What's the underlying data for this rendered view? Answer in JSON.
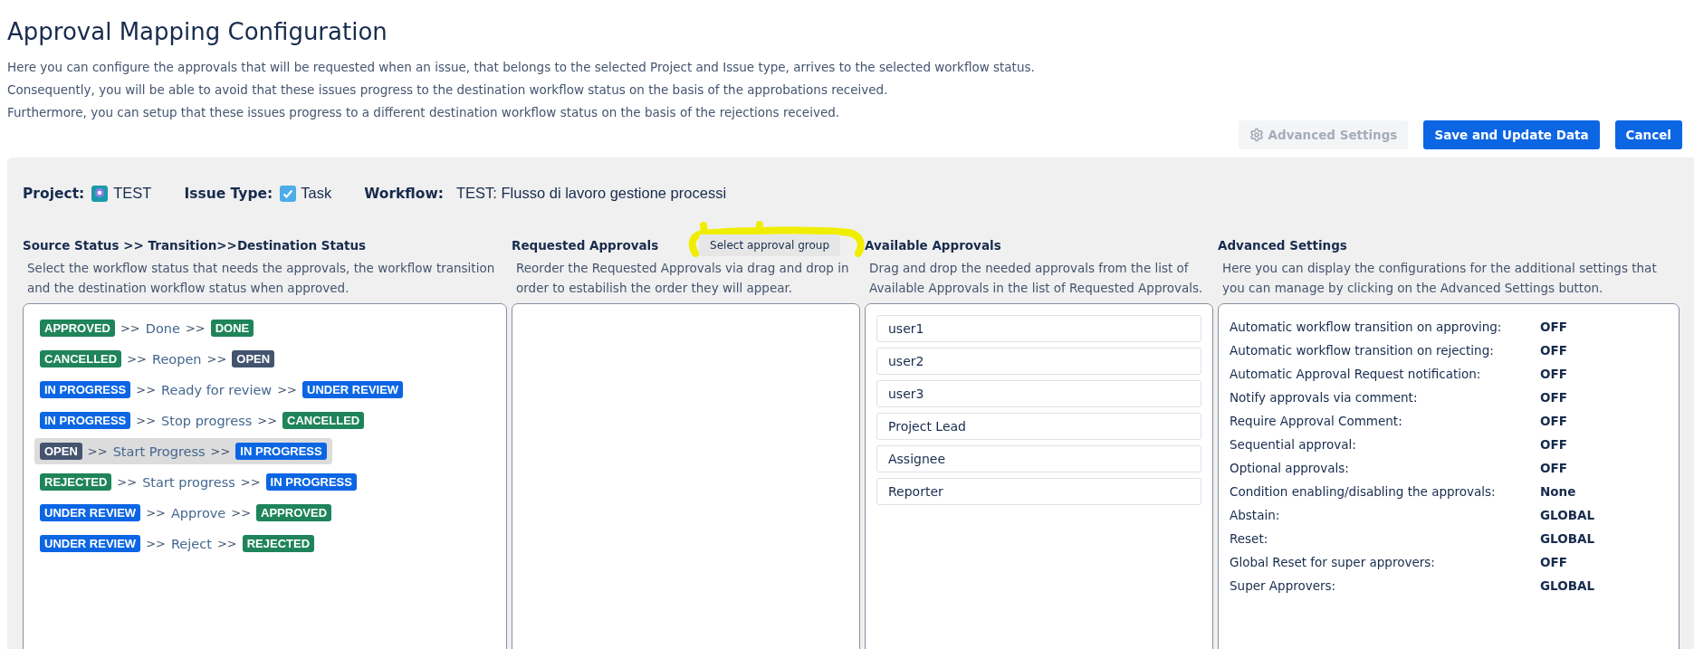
{
  "title": "Approval Mapping Configuration",
  "description": [
    "Here you can configure the approvals that will be requested when an issue, that belongs to the selected Project and Issue type, arrives to the selected workflow status.",
    "Consequently, you will be able to avoid that these issues progress to the destination workflow status on the basis of the approbations received.",
    "Furthermore, you can setup that these issues progress to a different destination workflow status on the basis of the rejections received."
  ],
  "actions": [
    {
      "label": "Advanced Settings",
      "kind": "settings",
      "disabled": true
    },
    {
      "label": "Save and Update Data",
      "kind": "primary",
      "disabled": false
    },
    {
      "label": "Cancel",
      "kind": "primary",
      "disabled": false
    }
  ],
  "context": {
    "project_label": "Project:",
    "project": "TEST",
    "issue_type_label": "Issue Type:",
    "issue_type": "Task",
    "workflow_label": "Workflow:",
    "workflow": "TEST: Flusso di lavoro gestione processi"
  },
  "transitions": {
    "heading": "Source Status >> Transition>>Destination Status",
    "help": "Select the workflow status that needs the approvals, the workflow transition and the destination workflow status when approved.",
    "separator": ">>",
    "rows": [
      {
        "source": {
          "label": "APPROVED",
          "color": "#1f845a"
        },
        "transition": "Done",
        "destination": {
          "label": "DONE",
          "color": "#1f845a"
        },
        "selected": false
      },
      {
        "source": {
          "label": "CANCELLED",
          "color": "#1f845a"
        },
        "transition": "Reopen",
        "destination": {
          "label": "OPEN",
          "color": "#44546f"
        },
        "selected": false
      },
      {
        "source": {
          "label": "IN PROGRESS",
          "color": "#0c66e4"
        },
        "transition": "Ready for review",
        "destination": {
          "label": "UNDER REVIEW",
          "color": "#0c66e4"
        },
        "selected": false
      },
      {
        "source": {
          "label": "IN PROGRESS",
          "color": "#0c66e4"
        },
        "transition": "Stop progress",
        "destination": {
          "label": "CANCELLED",
          "color": "#1f845a"
        },
        "selected": false
      },
      {
        "source": {
          "label": "OPEN",
          "color": "#44546f"
        },
        "transition": "Start Progress",
        "destination": {
          "label": "IN PROGRESS",
          "color": "#0c66e4"
        },
        "selected": true
      },
      {
        "source": {
          "label": "REJECTED",
          "color": "#1f845a"
        },
        "transition": "Start progress",
        "destination": {
          "label": "IN PROGRESS",
          "color": "#0c66e4"
        },
        "selected": false
      },
      {
        "source": {
          "label": "UNDER REVIEW",
          "color": "#0c66e4"
        },
        "transition": "Approve",
        "destination": {
          "label": "APPROVED",
          "color": "#1f845a"
        },
        "selected": false
      },
      {
        "source": {
          "label": "UNDER REVIEW",
          "color": "#0c66e4"
        },
        "transition": "Reject",
        "destination": {
          "label": "REJECTED",
          "color": "#1f845a"
        },
        "selected": false
      }
    ]
  },
  "requested": {
    "heading": "Requested Approvals",
    "group_button": "Select approval group",
    "help": "Reorder the Requested Approvals via drag and drop in order to estabilish the order they will appear."
  },
  "available": {
    "heading": "Available Approvals",
    "help": "Drag and drop the needed approvals from the list of Available Approvals in the list of Requested Approvals.",
    "items": [
      "user1",
      "user2",
      "user3",
      "Project Lead",
      "Assignee",
      "Reporter"
    ]
  },
  "advanced": {
    "heading": "Advanced Settings",
    "help": "Here you can display the configurations for the additional settings that you can manage by clicking on the Advanced Settings button.",
    "settings": [
      {
        "label": "Automatic workflow transition on approving:",
        "value": "OFF"
      },
      {
        "label": "Automatic workflow transition on rejecting:",
        "value": "OFF"
      },
      {
        "label": "Automatic Approval Request notification:",
        "value": "OFF"
      },
      {
        "label": "Notify approvals via comment:",
        "value": "OFF"
      },
      {
        "label": "Require Approval Comment:",
        "value": "OFF"
      },
      {
        "label": "Sequential approval:",
        "value": "OFF"
      },
      {
        "label": "Optional approvals:",
        "value": "OFF"
      },
      {
        "label": "Condition enabling/disabling the approvals:",
        "value": "None"
      },
      {
        "label": "Abstain:",
        "value": "GLOBAL"
      },
      {
        "label": "Reset:",
        "value": "GLOBAL"
      },
      {
        "label": "Global Reset for super approvers:",
        "value": "OFF"
      },
      {
        "label": "Super Approvers:",
        "value": "GLOBAL"
      }
    ]
  }
}
